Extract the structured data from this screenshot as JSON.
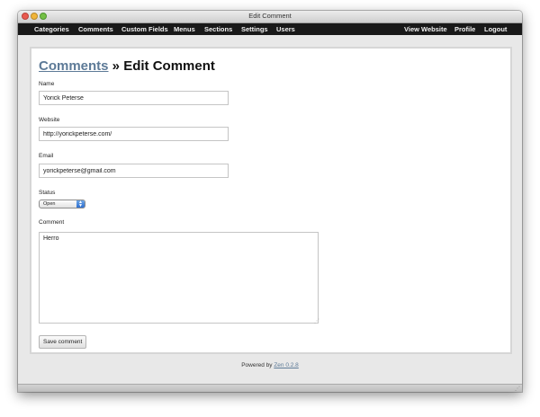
{
  "window": {
    "title": "Edit Comment"
  },
  "nav": {
    "left": [
      "Categories",
      "Comments",
      "Custom Fields",
      "Menus",
      "Sections",
      "Settings",
      "Users"
    ],
    "right": [
      "View Website",
      "Profile",
      "Logout"
    ]
  },
  "page": {
    "breadcrumb_link": "Comments",
    "separator": " » ",
    "title": "Edit Comment"
  },
  "form": {
    "name_label": "Name",
    "name_value": "Yorick Peterse",
    "website_label": "Website",
    "website_value": "http://yorickpeterse.com/",
    "email_label": "Email",
    "email_value": "yorickpeterse@gmail.com",
    "status_label": "Status",
    "status_value": "Open",
    "comment_label": "Comment",
    "comment_value": "Herro",
    "save_label": "Save comment"
  },
  "footer": {
    "prefix": "Powered by ",
    "link": "Zen 0.2.8"
  }
}
